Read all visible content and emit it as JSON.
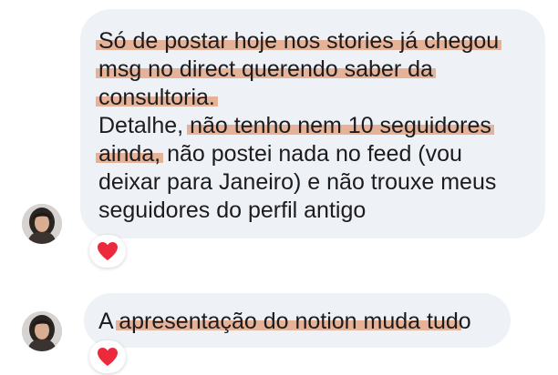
{
  "colors": {
    "bubble_background": "#eef1f5",
    "text": "#1c1c1e",
    "highlight": "#e4a07d",
    "heart": "#ed2a3b"
  },
  "messages": [
    {
      "lines": [
        [
          {
            "text": "Só de postar hoje nos stories já chegou",
            "highlight": true
          }
        ],
        [
          {
            "text": "msg no direct querendo saber da",
            "highlight": true
          }
        ],
        [
          {
            "text": "consultoria.",
            "highlight": true
          }
        ],
        [
          {
            "text": "Detalhe, ",
            "highlight": false
          },
          {
            "text": "não tenho nem 10 seguidores",
            "highlight": true
          }
        ],
        [
          {
            "text": "ainda,",
            "highlight": true
          },
          {
            "text": " não postei nada no feed (vou",
            "highlight": false
          }
        ],
        [
          {
            "text": "deixar para Janeiro) e não trouxe meus",
            "highlight": false
          }
        ],
        [
          {
            "text": "seguidores do perfil antigo",
            "highlight": false
          }
        ]
      ],
      "reaction_icon": "red-heart-icon",
      "avatar_icon": "user-avatar-photo"
    },
    {
      "lines": [
        [
          {
            "text": "A ",
            "highlight": false
          },
          {
            "text": "apresentação do notion muda tud",
            "highlight": true
          },
          {
            "text": "o",
            "highlight": false
          }
        ]
      ],
      "reaction_icon": "red-heart-icon",
      "avatar_icon": "user-avatar-photo"
    }
  ]
}
